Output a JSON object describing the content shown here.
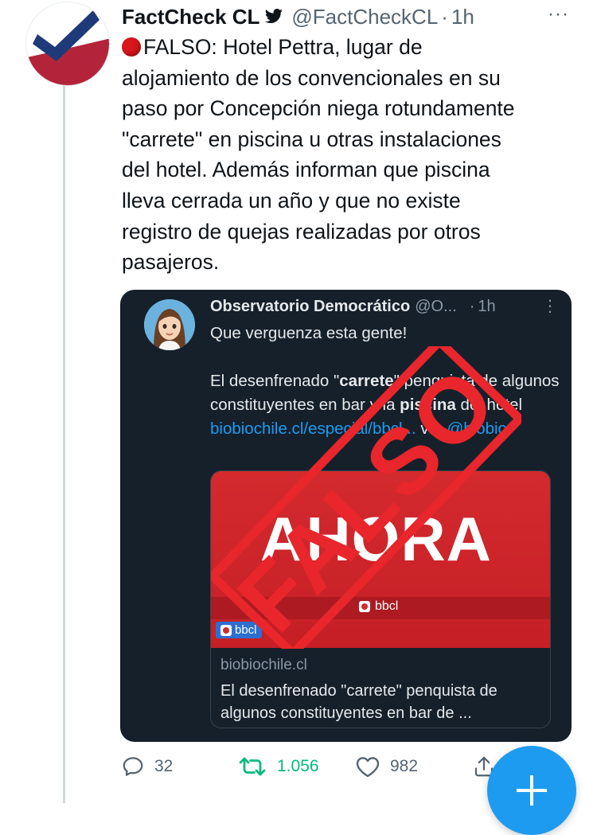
{
  "tweet": {
    "author": {
      "name": "FactCheck CL",
      "handle": "@FactCheckCL",
      "time": "1h",
      "verified_badge": "twitter-bird-icon"
    },
    "status_emoji": "red-circle-icon",
    "text_lines": [
      "FALSO: Hotel Pettra, lugar de",
      "alojamiento de los convencionales en su",
      "paso por Concepción niega rotundamente",
      "\"carrete\" en piscina u otras instalaciones",
      "del hotel. Además informan que piscina",
      "lleva cerrada un año y que no existe",
      "registro de quejas realizadas por otros",
      "pasajeros."
    ]
  },
  "quote": {
    "author": {
      "name": "Observatorio Democrático",
      "handle": "@O...",
      "time": "1h"
    },
    "line1": "Que verguenza esta gente!",
    "p2": {
      "a": "El desenfrenado \"",
      "b": "carrete",
      "c": "\" penquista de algunos constituyentes en bar y la ",
      "d": "piscina",
      "e": " del hotel ",
      "link1": "biobiochile.cl/",
      "link2": "especial/bbcl...",
      "f": " vía ",
      "link3": "@biobio"
    },
    "card": {
      "image_text": "AHORA",
      "image_brand": "bbcl",
      "badge": "bbcl",
      "domain": "biobiochile.cl",
      "title": "El desenfrenado \"carrete\" penquista de algunos constituyentes en bar de ..."
    },
    "stamp_text": "FALSO"
  },
  "actions": {
    "replies": "32",
    "retweets": "1.056",
    "likes": "982"
  },
  "colors": {
    "accent": "#1d9bf0",
    "retweet": "#00ba7c",
    "stamp": "#e8262b",
    "dark_card": "#15202b"
  }
}
